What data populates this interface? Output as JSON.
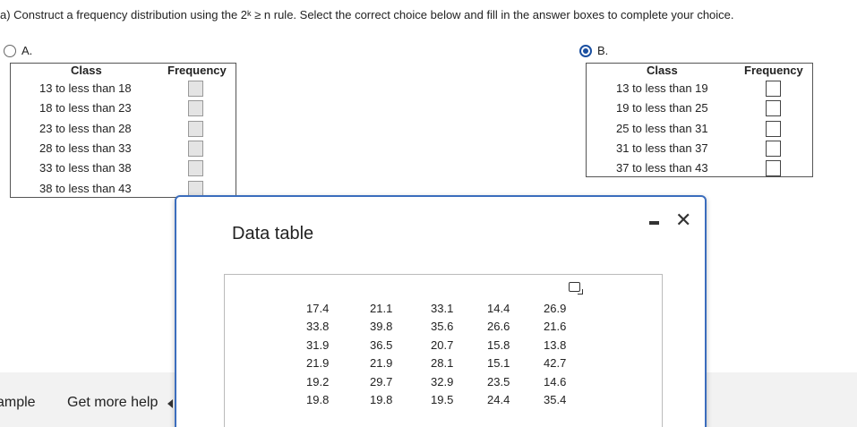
{
  "question": {
    "prefix": "a) Construct a frequency distribution using the 2",
    "superscript": "k",
    "suffix": " ≥ n rule. Select the correct choice below and fill in the answer boxes to complete your choice."
  },
  "choice_a": {
    "label": "A.",
    "selected": false,
    "class_header": "Class",
    "frequency_header": "Frequency",
    "rows": [
      "13 to less than 18",
      "18 to less than 23",
      "23 to less than 28",
      "28 to less than 33",
      "33 to less than 38",
      "38 to less than 43"
    ]
  },
  "choice_b": {
    "label": "B.",
    "selected": true,
    "class_header": "Class",
    "frequency_header": "Frequency",
    "rows": [
      "13 to less than 19",
      "19 to less than 25",
      "25 to less than 31",
      "31 to less than 37",
      "37 to less than 43"
    ]
  },
  "bottom_bar": {
    "left_text": "ample",
    "help_text": "Get more help"
  },
  "dialog": {
    "title": "Data table",
    "columns": [
      [
        "17.4",
        "33.8",
        "31.9",
        "21.9",
        "19.2",
        "19.8"
      ],
      [
        "21.1",
        "39.8",
        "36.5",
        "21.9",
        "29.7",
        "19.8"
      ],
      [
        "33.1",
        "35.6",
        "20.7",
        "28.1",
        "32.9",
        "19.5"
      ],
      [
        "14.4",
        "26.6",
        "15.8",
        "15.1",
        "23.5",
        "24.4"
      ],
      [
        "26.9",
        "21.6",
        "13.8",
        "42.7",
        "14.6",
        "35.4"
      ]
    ]
  }
}
